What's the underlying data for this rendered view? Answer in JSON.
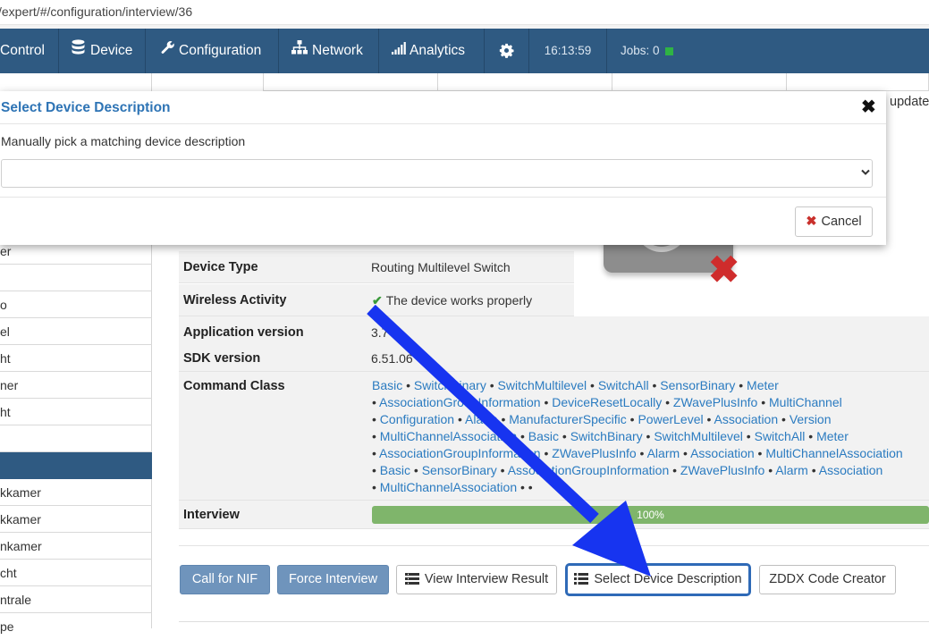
{
  "url": "/expert/#/configuration/interview/36",
  "nav": {
    "items": [
      {
        "label": "Control",
        "icon": ""
      },
      {
        "label": "Device",
        "icon": "database-icon"
      },
      {
        "label": "Configuration",
        "icon": "wrench-icon"
      },
      {
        "label": "Network",
        "icon": "network-icon"
      },
      {
        "label": "Analytics",
        "icon": "signal-icon"
      }
    ],
    "settings_icon": "gear-icon",
    "time": "16:13:59",
    "jobs": "Jobs: 0",
    "jobs_indicator_color": "#2fb344"
  },
  "sidebar": {
    "items": [
      "er",
      "",
      "o",
      "el",
      "ht",
      "ner",
      "ht",
      "",
      "",
      "kkamer",
      "kkamer",
      "nkamer",
      "cht",
      "ntrale",
      "pe"
    ],
    "active_color": "#2f5a82"
  },
  "partial_text": {
    "update": "update"
  },
  "details": {
    "device_type_label": "Device Type",
    "device_type_value": "Routing Multilevel Switch",
    "wireless_label": "Wireless Activity",
    "wireless_value": "The device works properly",
    "app_version_label": "Application version",
    "app_version_value": "3.7",
    "sdk_label": "SDK version",
    "sdk_value": "6.51.06",
    "cmd_label": "Command Class",
    "interview_label": "Interview",
    "interview_progress": "100%"
  },
  "command_classes": [
    [
      "Basic",
      "SwitchBinary",
      "SwitchMultilevel",
      "SwitchAll",
      "SensorBinary",
      "Meter"
    ],
    [
      "AssociationGroupInformation",
      "DeviceResetLocally",
      "ZWavePlusInfo",
      "MultiChannel"
    ],
    [
      "Configuration",
      "Alarm",
      "ManufacturerSpecific",
      "PowerLevel",
      "Association",
      "Version"
    ],
    [
      "MultiChannelAssociation",
      "Basic",
      "SwitchBinary",
      "SwitchMultilevel",
      "SwitchAll",
      "Meter"
    ],
    [
      "AssociationGroupInformation",
      "ZWavePlusInfo",
      "Alarm",
      "Association",
      "MultiChannelAssociation"
    ],
    [
      "Basic",
      "SensorBinary",
      "AssociationGroupInformation",
      "ZWavePlusInfo",
      "Alarm",
      "Association"
    ],
    [
      "MultiChannelAssociation",
      ""
    ]
  ],
  "buttons": {
    "call_nif": "Call for NIF",
    "force_interview": "Force Interview",
    "view_result": "View Interview Result",
    "select_desc": "Select Device Description",
    "zddx": "ZDDX Code Creator"
  },
  "modal": {
    "title": "Select Device Description",
    "text": "Manually pick a matching device description",
    "select_value": "",
    "cancel": "Cancel",
    "close_icon": "close-icon"
  },
  "colors": {
    "nav_bg": "#2f5a82",
    "link": "#2b7bc0",
    "progress": "#7fb56b",
    "arrow": "#1734f0",
    "error": "#cf2c2c"
  }
}
